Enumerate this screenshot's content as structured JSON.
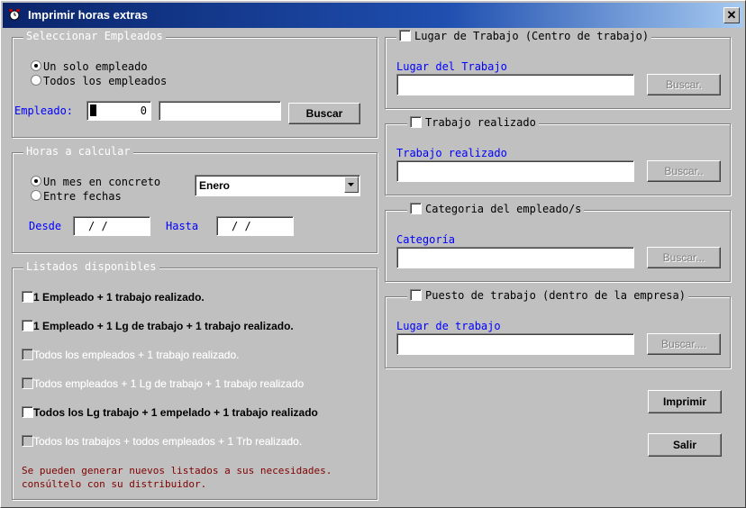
{
  "window": {
    "title": "Imprimir horas extras",
    "close_label": "✕"
  },
  "seleccionar": {
    "legend": "Seleccionar Empleados",
    "radio_one": "Un solo empleado",
    "radio_all": "Todos los empleados",
    "empleado_label": "Empleado:",
    "empleado_code": "0",
    "empleado_name": "",
    "buscar": "Buscar"
  },
  "horas": {
    "legend": "Horas a calcular",
    "radio_mes": "Un mes en concreto",
    "radio_fechas": "Entre fechas",
    "mes_value": "Enero",
    "desde_label": "Desde",
    "desde_value": "/ /",
    "hasta_label": "Hasta",
    "hasta_value": "/ /"
  },
  "listados": {
    "legend": "Listados disponibles",
    "items": [
      {
        "label": "1 Empleado + 1 trabajo realizado.",
        "enabled": true
      },
      {
        "label": "1 Empleado + 1 Lg de trabajo + 1 trabajo realizado.",
        "enabled": true
      },
      {
        "label": "Todos los empleados + 1 trabajo realizado.",
        "enabled": false
      },
      {
        "label": "Todos empleados + 1 Lg de trabajo + 1 trabajo realizado",
        "enabled": false
      },
      {
        "label": "Todos los Lg trabajo + 1 empelado + 1 trabajo realizado",
        "enabled": true
      },
      {
        "label": "Todos los trabajos + todos empleados + 1 Trb realizado.",
        "enabled": false
      }
    ],
    "note_line1": "Se pueden generar nuevos listados a sus necesidades.",
    "note_line2": "consúltelo con su distribuidor."
  },
  "lugar": {
    "legend": "Lugar de Trabajo (Centro de trabajo)",
    "label": "Lugar del Trabajo",
    "value": "",
    "buscar": "Buscar."
  },
  "trabajo": {
    "legend": "Trabajo realizado",
    "label": "Trabajo realizado",
    "value": "",
    "buscar": "Buscar.."
  },
  "categoria": {
    "legend": "Categoria del empleado/s",
    "label": "Categoría",
    "value": "",
    "buscar": "Buscar..."
  },
  "puesto": {
    "legend": "Puesto de trabajo (dentro de la empresa)",
    "label": "Lugar de trabajo",
    "value": "",
    "buscar": "Buscar...."
  },
  "actions": {
    "imprimir": "Imprimir",
    "salir": "Salir"
  },
  "colors": {
    "title_start": "#0a246a",
    "title_end": "#a6caf0",
    "label_blue": "#0000ff",
    "note_red": "#800000",
    "face": "#c0c0c0"
  }
}
